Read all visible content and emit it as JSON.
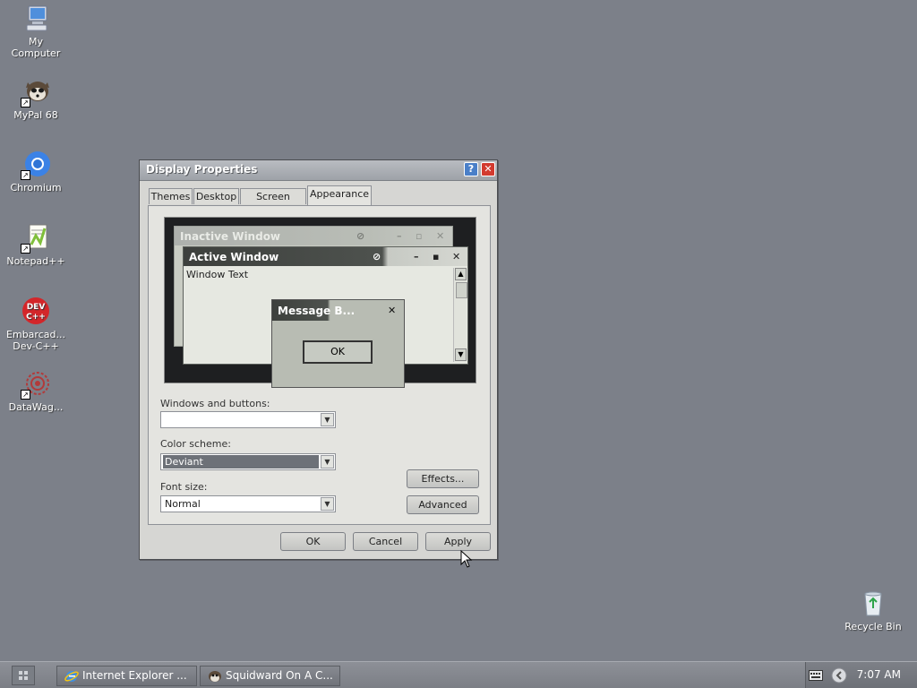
{
  "desktop": {
    "icons": [
      {
        "label": "My Computer"
      },
      {
        "label": "MyPal 68"
      },
      {
        "label": "Chromium"
      },
      {
        "label": "Notepad++"
      },
      {
        "label": "Embarcad... Dev-C++"
      },
      {
        "label": "DataWag..."
      },
      {
        "label": "Recycle Bin"
      }
    ]
  },
  "dialog": {
    "title": "Display Properties",
    "tabs": [
      "Themes",
      "Desktop",
      "Screen Saver",
      "Appearance"
    ],
    "active_tab": "Appearance",
    "preview": {
      "inactive_title": "Inactive Window",
      "active_title": "Active Window",
      "window_text": "Window Text",
      "message_title": "Message B...",
      "message_ok": "OK"
    },
    "windows_buttons_label": "Windows and buttons:",
    "windows_buttons_value": "",
    "color_scheme_label": "Color scheme:",
    "color_scheme_value": "Deviant",
    "font_size_label": "Font size:",
    "font_size_value": "Normal",
    "effects_label": "Effects...",
    "advanced_label": "Advanced",
    "ok_label": "OK",
    "cancel_label": "Cancel",
    "apply_label": "Apply"
  },
  "taskbar": {
    "tasks": [
      "Internet Explorer ...",
      "Squidward On A C..."
    ],
    "clock": "7:07 AM"
  },
  "colors": {
    "desktop": "#7c8089",
    "close_button": "#d23a2f",
    "help_button": "#4a7fc8"
  }
}
